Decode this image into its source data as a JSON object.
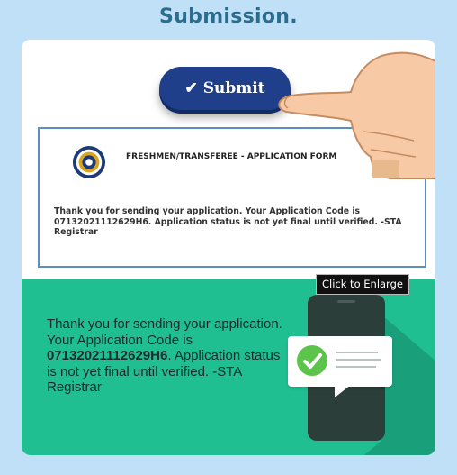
{
  "page": {
    "title": "Submission."
  },
  "submit_button": {
    "label": "Submit",
    "icon": "check-icon"
  },
  "form": {
    "title": "FRESHMEN/TRANSFEREE - APPLICATION FORM",
    "message": "Thank you for sending your application. Your Application Code is 07132021112629H6. Application status is not yet final until verified. -STA Registrar"
  },
  "green_panel": {
    "message_before": "Thank you for sending your application. Your Application Code is ",
    "code": "07132021112629H6",
    "message_after": ". Application status is not yet final until verified. -STA Registrar"
  },
  "tooltip": {
    "label": "Click to Enlarge"
  },
  "colors": {
    "background": "#bfe0f6",
    "title": "#2b6d8e",
    "button": "#1f3f8a",
    "green_panel": "#1fbf92",
    "check_green": "#5cc44a"
  }
}
